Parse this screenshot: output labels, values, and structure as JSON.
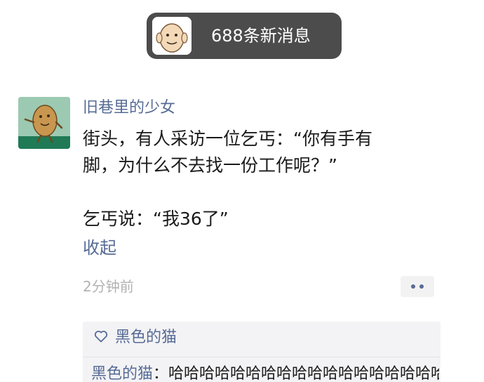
{
  "notification": {
    "avatar_icon": "potato-avatar-icon",
    "text": "688条新消息"
  },
  "post": {
    "avatar_icon": "potato-avatar-icon",
    "author": "旧巷里的少女",
    "content_lines": [
      "街头，有人采访一位乞丐：“你有手有",
      "脚，为什么不去找一份工作呢？”",
      "",
      "乞丐说：“我36了”"
    ],
    "collapse_label": "收起",
    "time": "2分钟前",
    "more_icon": "more-dots-icon"
  },
  "interactions": {
    "like_icon": "heart-outline-icon",
    "likes": [
      "黑色的猫"
    ],
    "comments": [
      {
        "author": "黑色的猫",
        "separator": "：",
        "text": "哈哈哈哈哈哈哈哈哈哈哈哈哈哈哈哈哈哈"
      }
    ]
  },
  "colors": {
    "link_blue": "#576b95",
    "pill_bg": "#4c4c4c",
    "meta_gray": "#b2b2b2",
    "comment_bg": "#f3f3f5"
  }
}
